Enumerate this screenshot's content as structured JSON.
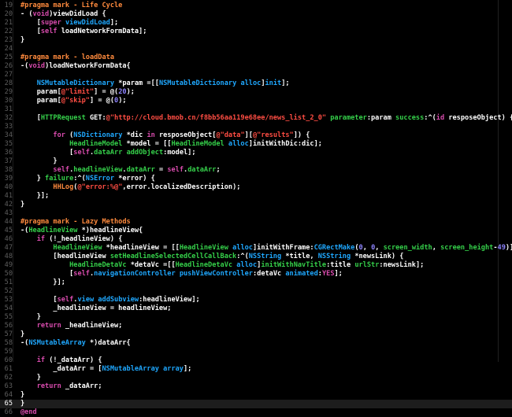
{
  "editor": {
    "colors": {
      "background": "#000000",
      "plain": "#ffffff",
      "keyword": "#d84bad",
      "preprocessor": "#ff8a3d",
      "string": "#ff4d43",
      "number": "#8e84ff",
      "type": "#1fa8ff",
      "method": "#35d04a"
    },
    "current_line": 65,
    "lines": [
      {
        "n": "19",
        "tokens": [
          [
            "pp",
            "#pragma mark - Life Cycle"
          ]
        ]
      },
      {
        "n": "20",
        "tokens": [
          [
            "pl",
            "- ("
          ],
          [
            "kw",
            "void"
          ],
          [
            "pl",
            ")viewDidLoad {"
          ]
        ]
      },
      {
        "n": "21",
        "tokens": [
          [
            "pl",
            "    ["
          ],
          [
            "kw",
            "super"
          ],
          [
            "pl",
            " "
          ],
          [
            "typ",
            "viewDidLoad"
          ],
          [
            "pl",
            "];"
          ]
        ]
      },
      {
        "n": "22",
        "tokens": [
          [
            "pl",
            "    ["
          ],
          [
            "kw",
            "self"
          ],
          [
            "pl",
            " loadNetworkFormData];"
          ]
        ]
      },
      {
        "n": "23",
        "tokens": [
          [
            "pl",
            "}"
          ]
        ]
      },
      {
        "n": "24",
        "tokens": [
          [
            "pl",
            ""
          ]
        ]
      },
      {
        "n": "25",
        "tokens": [
          [
            "pp",
            "#pragma mark - loadData"
          ]
        ]
      },
      {
        "n": "26",
        "tokens": [
          [
            "pl",
            "-("
          ],
          [
            "kw",
            "void"
          ],
          [
            "pl",
            ")loadNetworkFormData{"
          ]
        ]
      },
      {
        "n": "27",
        "tokens": [
          [
            "pl",
            ""
          ]
        ]
      },
      {
        "n": "28",
        "tokens": [
          [
            "pl",
            "    "
          ],
          [
            "typ",
            "NSMutableDictionary"
          ],
          [
            "pl",
            " *param =[["
          ],
          [
            "typ",
            "NSMutableDictionary"
          ],
          [
            "pl",
            " "
          ],
          [
            "typ",
            "alloc"
          ],
          [
            "pl",
            "]"
          ],
          [
            "typ",
            "init"
          ],
          [
            "pl",
            "];"
          ]
        ]
      },
      {
        "n": "29",
        "tokens": [
          [
            "pl",
            "    param["
          ],
          [
            "str",
            "@\"limit\""
          ],
          [
            "pl",
            "] = @("
          ],
          [
            "num",
            "20"
          ],
          [
            "pl",
            ");"
          ]
        ]
      },
      {
        "n": "30",
        "tokens": [
          [
            "pl",
            "    param["
          ],
          [
            "str",
            "@\"skip\""
          ],
          [
            "pl",
            "] = @("
          ],
          [
            "num",
            "0"
          ],
          [
            "pl",
            ");"
          ]
        ]
      },
      {
        "n": "31",
        "tokens": [
          [
            "pl",
            ""
          ]
        ]
      },
      {
        "n": "32",
        "tokens": [
          [
            "pl",
            "    ["
          ],
          [
            "fn",
            "HTTPRequest"
          ],
          [
            "pl",
            " GET:"
          ],
          [
            "str",
            "@\"http://cloud.bmob.cn/f8bb56aa119e68ee/news_list_2_0\""
          ],
          [
            "pl",
            " "
          ],
          [
            "fn",
            "parameter"
          ],
          [
            "pl",
            ":param "
          ],
          [
            "fn",
            "success"
          ],
          [
            "pl",
            ":^("
          ],
          [
            "kw",
            "id"
          ],
          [
            "pl",
            " resposeObject) {"
          ]
        ]
      },
      {
        "n": "33",
        "tokens": [
          [
            "pl",
            ""
          ]
        ]
      },
      {
        "n": "34",
        "tokens": [
          [
            "pl",
            "        "
          ],
          [
            "kw",
            "for"
          ],
          [
            "pl",
            " ("
          ],
          [
            "typ",
            "NSDictionary"
          ],
          [
            "pl",
            " *dic "
          ],
          [
            "kw",
            "in"
          ],
          [
            "pl",
            " resposeObject["
          ],
          [
            "str",
            "@\"data\""
          ],
          [
            "pl",
            "]["
          ],
          [
            "str",
            "@\"results\""
          ],
          [
            "pl",
            "]) {"
          ]
        ]
      },
      {
        "n": "35",
        "tokens": [
          [
            "pl",
            "            "
          ],
          [
            "fn",
            "HeadlineModel"
          ],
          [
            "pl",
            " *model = [["
          ],
          [
            "fn",
            "HeadlineModel"
          ],
          [
            "pl",
            " "
          ],
          [
            "typ",
            "alloc"
          ],
          [
            "pl",
            "]initWithDic:dic];"
          ]
        ]
      },
      {
        "n": "36",
        "tokens": [
          [
            "pl",
            "            ["
          ],
          [
            "kw",
            "self"
          ],
          [
            "pl",
            "."
          ],
          [
            "fn",
            "dataArr"
          ],
          [
            "pl",
            " "
          ],
          [
            "fn",
            "addObject"
          ],
          [
            "pl",
            ":model];"
          ]
        ]
      },
      {
        "n": "37",
        "tokens": [
          [
            "pl",
            "        }"
          ]
        ]
      },
      {
        "n": "38",
        "tokens": [
          [
            "pl",
            "        "
          ],
          [
            "kw",
            "self"
          ],
          [
            "pl",
            "."
          ],
          [
            "fn",
            "headlineView"
          ],
          [
            "pl",
            "."
          ],
          [
            "fn",
            "dataArr"
          ],
          [
            "pl",
            " = "
          ],
          [
            "kw",
            "self"
          ],
          [
            "pl",
            "."
          ],
          [
            "fn",
            "dataArr"
          ],
          [
            "pl",
            ";"
          ]
        ]
      },
      {
        "n": "39",
        "tokens": [
          [
            "pl",
            "    } "
          ],
          [
            "fn",
            "failure"
          ],
          [
            "pl",
            ":^("
          ],
          [
            "typ",
            "NSError"
          ],
          [
            "pl",
            " *error) {"
          ]
        ]
      },
      {
        "n": "40",
        "tokens": [
          [
            "pl",
            "        "
          ],
          [
            "pp",
            "HHLog"
          ],
          [
            "pl",
            "("
          ],
          [
            "str",
            "@\"error:%@\""
          ],
          [
            "pl",
            ",error.localizedDescription);"
          ]
        ]
      },
      {
        "n": "41",
        "tokens": [
          [
            "pl",
            "    }];"
          ]
        ]
      },
      {
        "n": "42",
        "tokens": [
          [
            "pl",
            "}"
          ]
        ]
      },
      {
        "n": "43",
        "tokens": [
          [
            "pl",
            ""
          ]
        ]
      },
      {
        "n": "44",
        "tokens": [
          [
            "pp",
            "#pragma mark - Lazy Methods"
          ]
        ]
      },
      {
        "n": "45",
        "tokens": [
          [
            "pl",
            "-("
          ],
          [
            "fn",
            "HeadlineView"
          ],
          [
            "pl",
            " *)headlineView{"
          ]
        ]
      },
      {
        "n": "46",
        "tokens": [
          [
            "pl",
            "    "
          ],
          [
            "kw",
            "if"
          ],
          [
            "pl",
            " (!_headlineView) {"
          ]
        ]
      },
      {
        "n": "47",
        "tokens": [
          [
            "pl",
            "        "
          ],
          [
            "fn",
            "HeadlineView"
          ],
          [
            "pl",
            " *headlineView = [["
          ],
          [
            "fn",
            "HeadlineView"
          ],
          [
            "pl",
            " "
          ],
          [
            "typ",
            "alloc"
          ],
          [
            "pl",
            "]initWithFrame:"
          ],
          [
            "typ",
            "CGRectMake"
          ],
          [
            "pl",
            "("
          ],
          [
            "num",
            "0"
          ],
          [
            "pl",
            ", "
          ],
          [
            "num",
            "0"
          ],
          [
            "pl",
            ", "
          ],
          [
            "fn",
            "screen_width"
          ],
          [
            "pl",
            ", "
          ],
          [
            "fn",
            "screen_height"
          ],
          [
            "pl",
            "-"
          ],
          [
            "num",
            "49"
          ],
          [
            "pl",
            ")];"
          ]
        ]
      },
      {
        "n": "48",
        "tokens": [
          [
            "pl",
            "        [headlineView "
          ],
          [
            "fn",
            "setHeadlineSelectedCellCallBack"
          ],
          [
            "pl",
            ":^("
          ],
          [
            "typ",
            "NSString"
          ],
          [
            "pl",
            " *title, "
          ],
          [
            "typ",
            "NSString"
          ],
          [
            "pl",
            " *newsLink) {"
          ]
        ]
      },
      {
        "n": "49",
        "tokens": [
          [
            "pl",
            "            "
          ],
          [
            "fn",
            "HeadlineDetaVc"
          ],
          [
            "pl",
            " *detaVc =[["
          ],
          [
            "fn",
            "HeadlineDetaVc"
          ],
          [
            "pl",
            " "
          ],
          [
            "typ",
            "alloc"
          ],
          [
            "pl",
            "]"
          ],
          [
            "fn",
            "initWithNavTitle"
          ],
          [
            "pl",
            ":title "
          ],
          [
            "fn",
            "urlStr"
          ],
          [
            "pl",
            ":newsLink];"
          ]
        ]
      },
      {
        "n": "50",
        "tokens": [
          [
            "pl",
            "            ["
          ],
          [
            "kw",
            "self"
          ],
          [
            "pl",
            "."
          ],
          [
            "typ",
            "navigationController"
          ],
          [
            "pl",
            " "
          ],
          [
            "typ",
            "pushViewController"
          ],
          [
            "pl",
            ":detaVc "
          ],
          [
            "typ",
            "animated"
          ],
          [
            "pl",
            ":"
          ],
          [
            "kw",
            "YES"
          ],
          [
            "pl",
            "];"
          ]
        ]
      },
      {
        "n": "51",
        "tokens": [
          [
            "pl",
            "        }];"
          ]
        ]
      },
      {
        "n": "52",
        "tokens": [
          [
            "pl",
            ""
          ]
        ]
      },
      {
        "n": "53",
        "tokens": [
          [
            "pl",
            "        ["
          ],
          [
            "kw",
            "self"
          ],
          [
            "pl",
            "."
          ],
          [
            "typ",
            "view"
          ],
          [
            "pl",
            " "
          ],
          [
            "typ",
            "addSubview"
          ],
          [
            "pl",
            ":headlineView];"
          ]
        ]
      },
      {
        "n": "54",
        "tokens": [
          [
            "pl",
            "        _headlineView = headlineView;"
          ]
        ]
      },
      {
        "n": "55",
        "tokens": [
          [
            "pl",
            "    }"
          ]
        ]
      },
      {
        "n": "56",
        "tokens": [
          [
            "pl",
            "    "
          ],
          [
            "kw",
            "return"
          ],
          [
            "pl",
            " _headlineView;"
          ]
        ]
      },
      {
        "n": "57",
        "tokens": [
          [
            "pl",
            "}"
          ]
        ]
      },
      {
        "n": "58",
        "tokens": [
          [
            "pl",
            "-("
          ],
          [
            "typ",
            "NSMutableArray"
          ],
          [
            "pl",
            " *)dataArr{"
          ]
        ]
      },
      {
        "n": "59",
        "tokens": [
          [
            "pl",
            ""
          ]
        ]
      },
      {
        "n": "60",
        "tokens": [
          [
            "pl",
            "    "
          ],
          [
            "kw",
            "if"
          ],
          [
            "pl",
            " (!_dataArr) {"
          ]
        ]
      },
      {
        "n": "61",
        "tokens": [
          [
            "pl",
            "        _dataArr = ["
          ],
          [
            "typ",
            "NSMutableArray"
          ],
          [
            "pl",
            " "
          ],
          [
            "typ",
            "array"
          ],
          [
            "pl",
            "];"
          ]
        ]
      },
      {
        "n": "62",
        "tokens": [
          [
            "pl",
            "    }"
          ]
        ]
      },
      {
        "n": "63",
        "tokens": [
          [
            "pl",
            "    "
          ],
          [
            "kw",
            "return"
          ],
          [
            "pl",
            " _dataArr;"
          ]
        ]
      },
      {
        "n": "64",
        "tokens": [
          [
            "pl",
            "}"
          ]
        ]
      },
      {
        "n": "65",
        "tokens": [
          [
            "pl",
            "}"
          ]
        ]
      },
      {
        "n": "66",
        "tokens": [
          [
            "kw",
            "@end"
          ]
        ]
      }
    ]
  }
}
